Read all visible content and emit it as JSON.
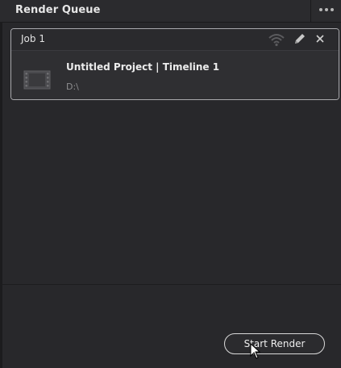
{
  "panel": {
    "title": "Render Queue",
    "more_icon": "more-horizontal-icon"
  },
  "job": {
    "title": "Job 1",
    "icons": [
      "wifi-icon",
      "pencil-icon",
      "close-icon"
    ],
    "project_name": "Untitled Project | Timeline 1",
    "path": "D:\\",
    "thumbnail_icon": "film-icon"
  },
  "footer": {
    "start_render_label": "Start Render"
  },
  "colors": {
    "panel_bg": "#28282b",
    "card_border": "#a9a9ad",
    "text_primary": "#ececec",
    "text_secondary": "#8d8d8f"
  }
}
